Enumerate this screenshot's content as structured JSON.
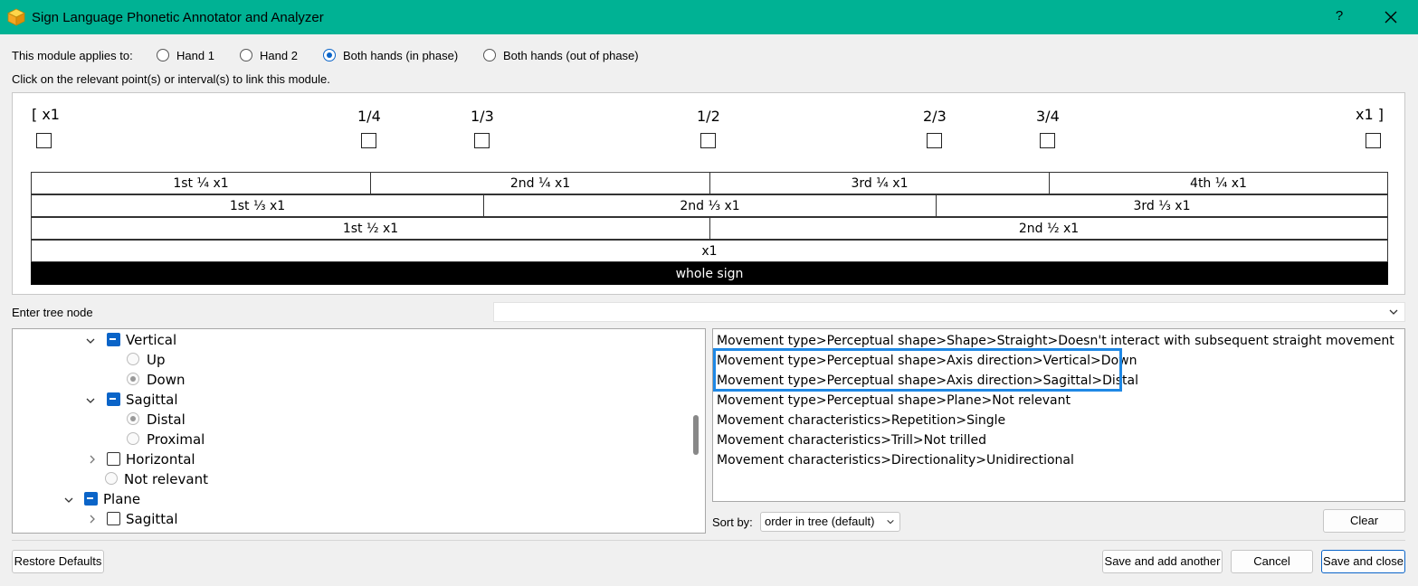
{
  "window": {
    "title": "Sign Language Phonetic Annotator and Analyzer",
    "help_label": "?",
    "accent_color": "#00b294"
  },
  "applies": {
    "label": "This module applies to:",
    "options": [
      "Hand 1",
      "Hand 2",
      "Both hands (in phase)",
      "Both hands (out of phase)"
    ],
    "selected": "Both hands (in phase)"
  },
  "instruction": "Click on the relevant point(s) or interval(s) to link this module.",
  "timeline": {
    "points": [
      "[ x1",
      "1/4",
      "1/3",
      "1/2",
      "2/3",
      "3/4",
      "x1 ]"
    ],
    "quarters": [
      "1st ¼ x1",
      "2nd ¼ x1",
      "3rd ¼ x1",
      "4th ¼ x1"
    ],
    "thirds": [
      "1st ⅓ x1",
      "2nd ⅓ x1",
      "3rd ⅓ x1"
    ],
    "halves": [
      "1st ½ x1",
      "2nd ½ x1"
    ],
    "whole": "x1",
    "whole_sign": "whole sign"
  },
  "tree_node": {
    "label": "Enter tree node",
    "value": ""
  },
  "tree": {
    "rows": [
      {
        "label": "Vertical",
        "kind": "checkbox-partial",
        "expand": "down"
      },
      {
        "label": "Up",
        "kind": "radio"
      },
      {
        "label": "Down",
        "kind": "radio-selected"
      },
      {
        "label": "Sagittal",
        "kind": "checkbox-partial",
        "expand": "down"
      },
      {
        "label": "Distal",
        "kind": "radio-selected"
      },
      {
        "label": "Proximal",
        "kind": "radio"
      },
      {
        "label": "Horizontal",
        "kind": "checkbox",
        "expand": "right"
      },
      {
        "label": "Not relevant",
        "kind": "radio"
      },
      {
        "label": "Plane",
        "kind": "checkbox-partial",
        "expand": "down"
      },
      {
        "label": "Sagittal",
        "kind": "checkbox",
        "expand": "right"
      }
    ]
  },
  "selections": [
    "Movement type>Perceptual shape>Shape>Straight>Doesn't interact with subsequent straight movement",
    "Movement type>Perceptual shape>Axis direction>Vertical>Down",
    "Movement type>Perceptual shape>Axis direction>Sagittal>Distal",
    "Movement type>Perceptual shape>Plane>Not relevant",
    "Movement characteristics>Repetition>Single",
    "Movement characteristics>Trill>Not trilled",
    "Movement characteristics>Directionality>Unidirectional"
  ],
  "sort": {
    "label": "Sort by:",
    "value": "order in tree (default)"
  },
  "buttons": {
    "clear": "Clear",
    "restore_defaults": "Restore Defaults",
    "save_add_another": "Save and add another",
    "cancel": "Cancel",
    "save_close": "Save and close"
  }
}
